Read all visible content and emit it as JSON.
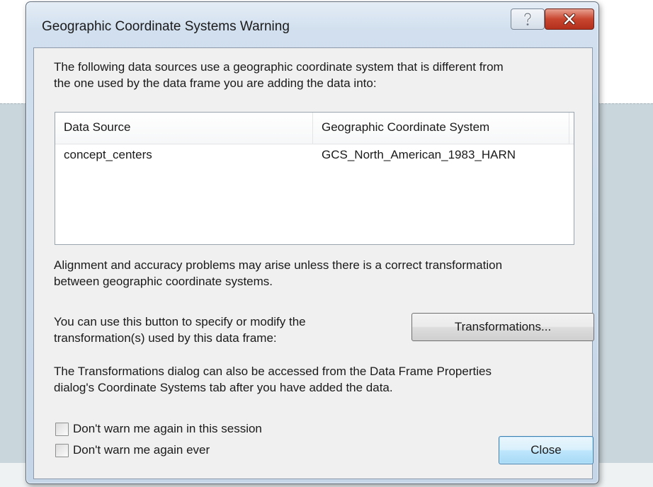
{
  "window": {
    "title": "Geographic Coordinate Systems Warning",
    "help_symbol": "?",
    "close_symbol": "x"
  },
  "intro": {
    "line1": "The following data sources use a geographic coordinate system that is different from",
    "line2": "the one used by the data frame you are adding the data into:"
  },
  "table": {
    "columns": [
      "Data Source",
      "Geographic Coordinate System"
    ],
    "rows": [
      [
        "concept_centers",
        "GCS_North_American_1983_HARN"
      ]
    ]
  },
  "alignment": {
    "line1": "Alignment and accuracy problems may arise unless there is a correct transformation",
    "line2": "between geographic coordinate systems."
  },
  "transform_note": {
    "line1": "You can use this button to specify or modify the",
    "line2": "transformation(s) used by this data frame:"
  },
  "transformations_button": "Transformations...",
  "access_note": {
    "line1": "The Transformations dialog can also be accessed from the Data Frame Properties",
    "line2": "dialog's Coordinate Systems tab after you have added the data."
  },
  "checkboxes": [
    {
      "label": "Don't warn me again in this session",
      "checked": false
    },
    {
      "label": "Don't warn me again ever",
      "checked": false
    }
  ],
  "close_button": "Close",
  "colors": {
    "title_close_red": "#c8452f",
    "default_button_blue": "#a7d9f5",
    "background_band": "#c9d6db"
  },
  "icons": [
    "help-icon",
    "close-icon"
  ]
}
